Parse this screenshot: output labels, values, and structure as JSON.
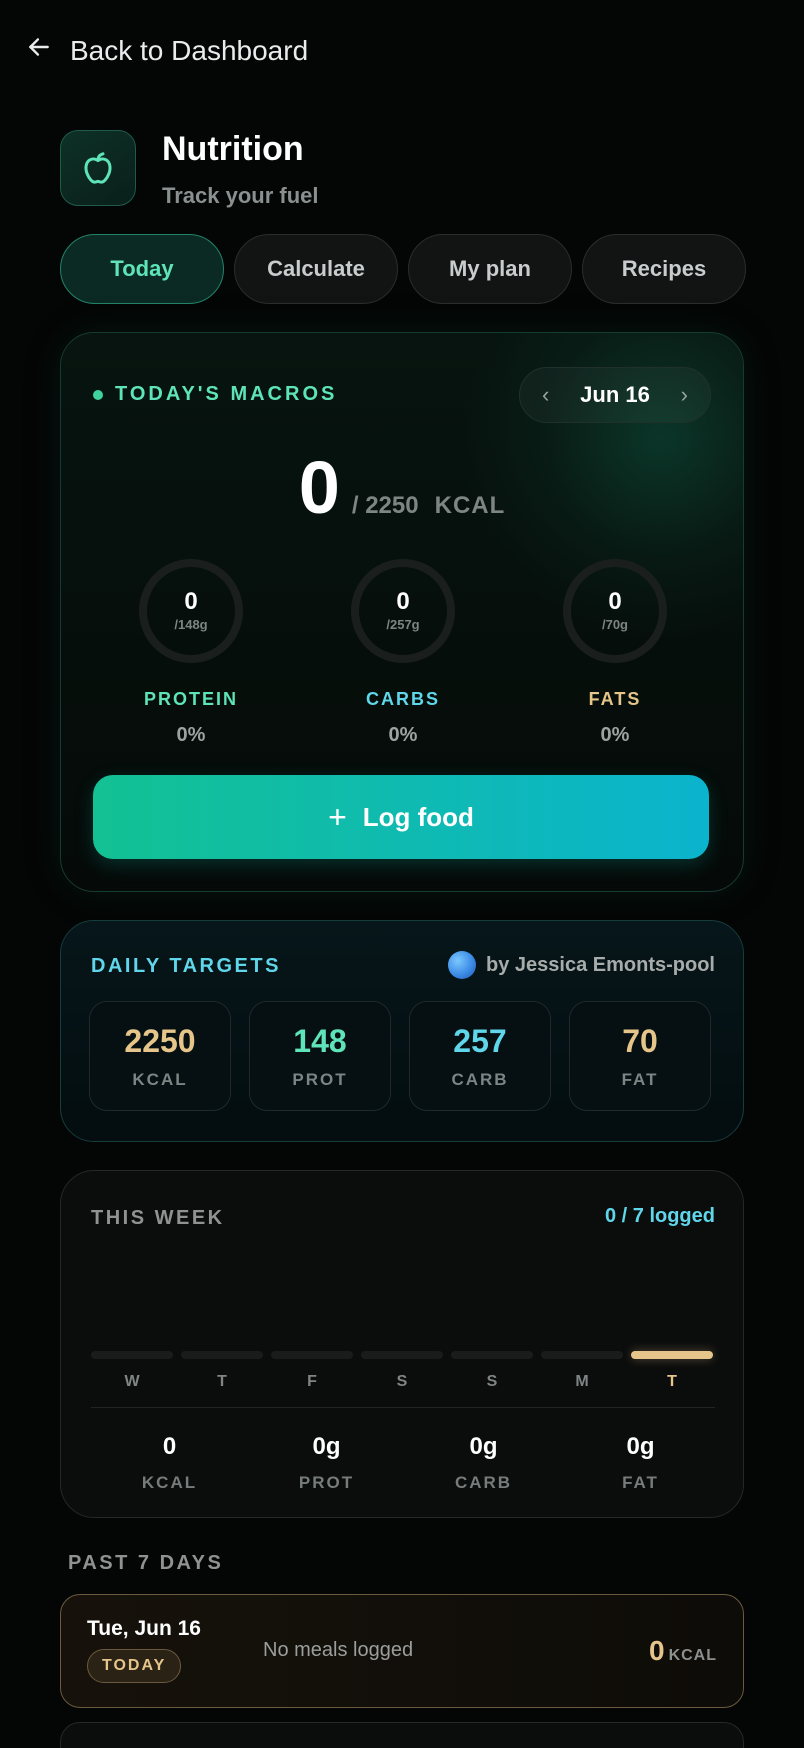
{
  "nav": {
    "back_label": "Back to Dashboard"
  },
  "header": {
    "title": "Nutrition",
    "subtitle": "Track your fuel"
  },
  "tabs": [
    {
      "label": "Today",
      "active": true
    },
    {
      "label": "Calculate",
      "active": false
    },
    {
      "label": "My plan",
      "active": false
    },
    {
      "label": "Recipes",
      "active": false
    }
  ],
  "macros": {
    "label": "TODAY'S MACROS",
    "date": "Jun 16",
    "kcal_current": "0",
    "kcal_target": "/ 2250",
    "kcal_unit": "KCAL",
    "items": [
      {
        "value": "0",
        "target": "/148g",
        "name": "PROTEIN",
        "percent": "0%",
        "color": "#5ee4b8"
      },
      {
        "value": "0",
        "target": "/257g",
        "name": "CARBS",
        "percent": "0%",
        "color": "#5fd6ea"
      },
      {
        "value": "0",
        "target": "/70g",
        "name": "FATS",
        "percent": "0%",
        "color": "#e6c58a"
      }
    ],
    "log_button": "Log food"
  },
  "targets": {
    "label": "DAILY TARGETS",
    "author": "by Jessica Emonts-pool",
    "items": [
      {
        "value": "2250",
        "label": "KCAL",
        "color": "#e6c58a"
      },
      {
        "value": "148",
        "label": "PROT",
        "color": "#5ee4b8"
      },
      {
        "value": "257",
        "label": "CARB",
        "color": "#5fd6ea"
      },
      {
        "value": "70",
        "label": "FAT",
        "color": "#e6c58a"
      }
    ]
  },
  "week": {
    "label": "THIS WEEK",
    "logged": "0 / 7 logged",
    "days": [
      {
        "day": "W",
        "current": false
      },
      {
        "day": "T",
        "current": false
      },
      {
        "day": "F",
        "current": false
      },
      {
        "day": "S",
        "current": false
      },
      {
        "day": "S",
        "current": false
      },
      {
        "day": "M",
        "current": false
      },
      {
        "day": "T",
        "current": true
      }
    ],
    "stats": [
      {
        "value": "0",
        "label": "KCAL"
      },
      {
        "value": "0g",
        "label": "PROT"
      },
      {
        "value": "0g",
        "label": "CARB"
      },
      {
        "value": "0g",
        "label": "FAT"
      }
    ]
  },
  "past": {
    "label": "PAST 7 DAYS",
    "entries": [
      {
        "date": "Tue, Jun 16",
        "badge": "TODAY",
        "note": "No meals logged",
        "kcal": "0",
        "unit": "KCAL"
      }
    ]
  },
  "colors": {
    "accent_green": "#5ee4b8",
    "accent_cyan": "#5fd6ea",
    "accent_gold": "#e6c58a"
  }
}
